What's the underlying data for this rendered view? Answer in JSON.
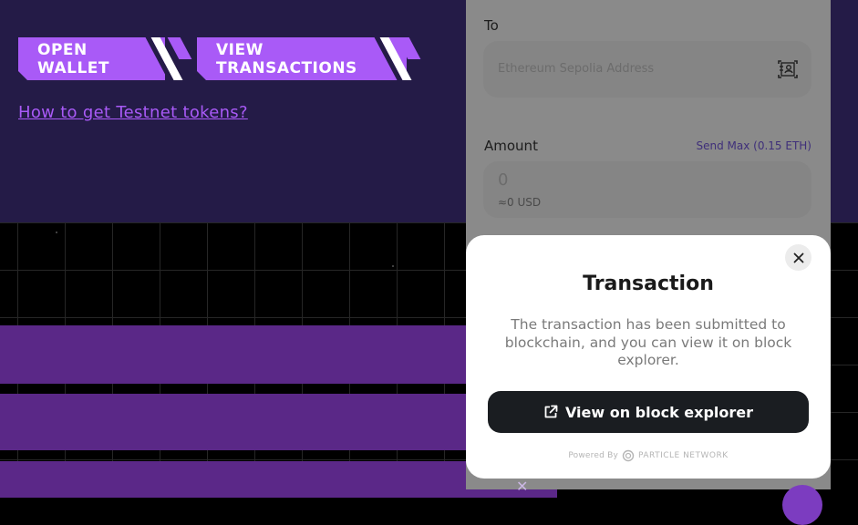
{
  "header": {
    "open_wallet_label": "OPEN WALLET",
    "view_transactions_label": "VIEW TRANSACTIONS",
    "testnet_link": "How to get Testnet tokens?"
  },
  "send_form": {
    "to_label": "To",
    "to_placeholder": "Ethereum Sepolia Address",
    "amount_label": "Amount",
    "send_max_label": "Send Max (0.15 ETH)",
    "amount_value": "0",
    "usd_value": "≈0 USD"
  },
  "modal": {
    "title": "Transaction",
    "description": "The transaction has been submitted to blockchain, and you can view it on block explorer.",
    "explorer_button": "View on block explorer",
    "powered_by": "Powered By",
    "brand": "PARTICLE NETWORK"
  },
  "icons": [
    "address-book-icon",
    "close-icon",
    "external-link-icon",
    "particle-logo-icon"
  ],
  "colors": {
    "accent_purple": "#a95af7",
    "top_panel": "#241b47",
    "band_purple": "#5a2887",
    "modal_button": "#1a1d21"
  }
}
